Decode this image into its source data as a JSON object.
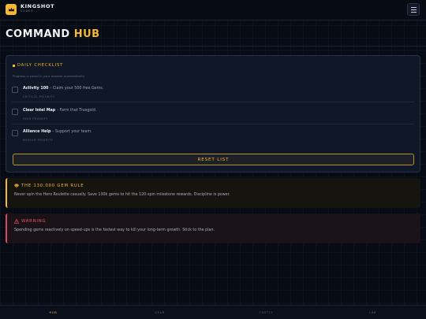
{
  "header": {
    "brand_name": "KINGSHOT",
    "brand_sub": "CODEX",
    "menu_icon": "hamburger-menu-icon",
    "logo_icon": "crown-logo-icon"
  },
  "page": {
    "title_main": "COMMAND ",
    "title_accent": "HUB"
  },
  "checklist": {
    "title": "DAILY CHECKLIST",
    "subtitle": "Progress is saved in your browser automatically.",
    "tasks": [
      {
        "name": "Activity 100",
        "desc": " – Claim your 500 free Gems.",
        "priority": "CRITICAL PRIORITY",
        "checked": false
      },
      {
        "name": "Clear Intel Map",
        "desc": " – Farm that Truegold.",
        "priority": "HIGH PRIORITY",
        "checked": false
      },
      {
        "name": "Alliance Help",
        "desc": " – Support your team.",
        "priority": "MEDIUM PRIORITY",
        "checked": false
      }
    ],
    "reset_label": "RESET LIST"
  },
  "rule_panel": {
    "icon": "gem-icon",
    "title": "THE 130,000 GEM RULE",
    "body": "Never spin the Hero Roulette casually. Save 130k gems to hit the 120-spin milestone rewards. Discipline is power."
  },
  "warning_panel": {
    "icon": "warning-icon",
    "title": "WARNING",
    "body": "Spending gems reactively on speed-ups is the fastest way to kill your long-term growth. Stick to the plan."
  },
  "bottom_nav": {
    "items": [
      {
        "label": "HUB",
        "active": true
      },
      {
        "label": "GEAR",
        "active": false
      },
      {
        "label": "CASTLE",
        "active": false
      },
      {
        "label": "LAB",
        "active": false
      }
    ]
  },
  "colors": {
    "accent": "#f5b82e",
    "danger": "#d64a5e",
    "background": "#070b14",
    "card": "#111928"
  }
}
